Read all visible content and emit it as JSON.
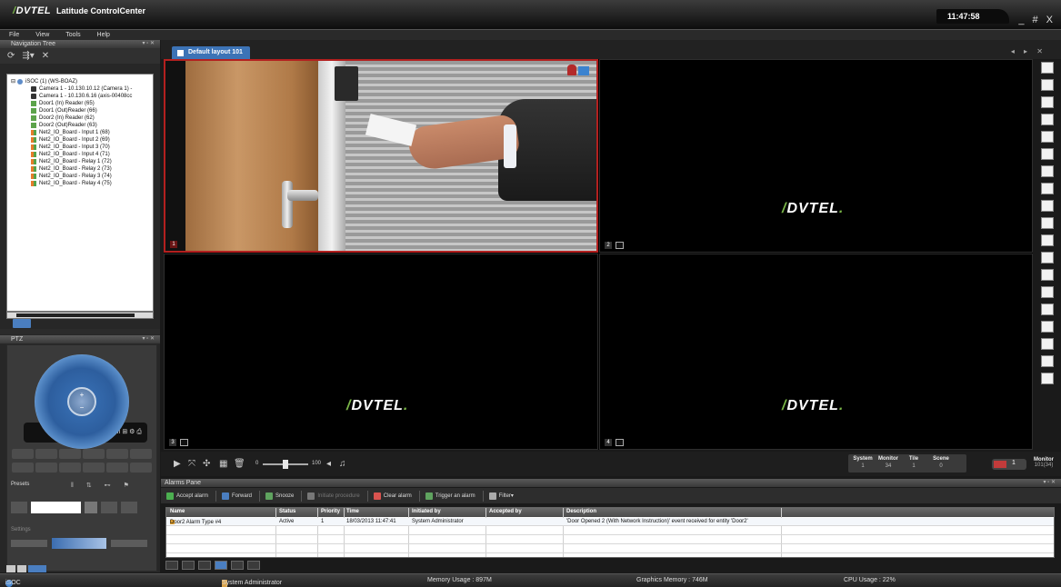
{
  "app": {
    "logo": "DVTEL",
    "title": "Latitude ControlCenter",
    "clock": "11:47:58",
    "window_controls": "_ # X"
  },
  "menu": [
    "File",
    "View",
    "Tools",
    "Help"
  ],
  "navigation_tree": {
    "title": "Navigation Tree",
    "items": [
      {
        "label": "iSOC (1) (WS-BOAZ)",
        "icon": "server-icon",
        "level": 0
      },
      {
        "label": "Camera 1 - 10.130.10.12 (Camera 1) -",
        "icon": "camera-icon",
        "level": 1
      },
      {
        "label": "Camera 1 - 10.130.6.16 (axis-00408cc",
        "icon": "camera-icon",
        "level": 1
      },
      {
        "label": "Door1 (In) Reader (65)",
        "icon": "door-reader-icon",
        "level": 1
      },
      {
        "label": "Door1 (Out)Reader (66)",
        "icon": "door-reader-icon",
        "level": 1
      },
      {
        "label": "Door2 (In) Reader (62)",
        "icon": "door-reader-icon",
        "level": 1
      },
      {
        "label": "Door2 (Out)Reader (63)",
        "icon": "door-reader-icon",
        "level": 1
      },
      {
        "label": "Net2_IO_Board - Input 1 (68)",
        "icon": "io-board-icon",
        "level": 1
      },
      {
        "label": "Net2_IO_Board - Input 2 (69)",
        "icon": "io-board-icon",
        "level": 1
      },
      {
        "label": "Net2_IO_Board - Input 3 (70)",
        "icon": "io-board-icon",
        "level": 1
      },
      {
        "label": "Net2_IO_Board - Input 4 (71)",
        "icon": "io-board-icon",
        "level": 1
      },
      {
        "label": "Net2_IO_Board - Relay 1 (72)",
        "icon": "io-board-icon",
        "level": 1
      },
      {
        "label": "Net2_IO_Board - Relay 2 (73)",
        "icon": "io-board-icon",
        "level": 1
      },
      {
        "label": "Net2_IO_Board - Relay 3 (74)",
        "icon": "io-board-icon",
        "level": 1
      },
      {
        "label": "Net2_IO_Board - Relay 4 (75)",
        "icon": "io-board-icon",
        "level": 1
      }
    ]
  },
  "ptz": {
    "title": "PTZ",
    "presets_label": "Presets",
    "settings_label": "Settings"
  },
  "layout": {
    "tab_label": "Default layout 101",
    "tiles": [
      {
        "number": "1",
        "content": "camera-feed",
        "selected": true
      },
      {
        "number": "2",
        "content": "DVTEL"
      },
      {
        "number": "3",
        "content": "DVTEL"
      },
      {
        "number": "4",
        "content": "DVTEL"
      }
    ]
  },
  "view_toolbar": {
    "zoom_min": "0",
    "zoom_max": "100",
    "status": [
      {
        "label": "System",
        "value": "1"
      },
      {
        "label": "Monitor",
        "value": "34"
      },
      {
        "label": "Tile",
        "value": "1"
      },
      {
        "label": "Scene",
        "value": "0"
      }
    ],
    "monitor_number": "1",
    "monitor_label": "Monitor",
    "monitor_id": "101(34)"
  },
  "alarms": {
    "title": "Alarms Pane",
    "actions": [
      {
        "label": "Accept alarm",
        "color": "#4caf50",
        "enabled": true
      },
      {
        "label": "Forward",
        "color": "#4a7ec0",
        "enabled": true
      },
      {
        "label": "Snooze",
        "color": "#5fa35f",
        "enabled": true
      },
      {
        "label": "Initiate procedure",
        "color": "#777777",
        "enabled": false
      },
      {
        "label": "Clear alarm",
        "color": "#d9534f",
        "enabled": true
      },
      {
        "label": "Trigger an alarm",
        "color": "#5fa35f",
        "enabled": true
      },
      {
        "label": "Filter",
        "color": "#aaaaaa",
        "enabled": true
      }
    ],
    "columns": [
      "Name",
      "Status",
      "Priority",
      "Time",
      "Initiated by",
      "Accepted by",
      "Description"
    ],
    "rows": [
      {
        "name": "Door2 Alarm Type #4",
        "status": "Active",
        "priority": "1",
        "time": "18/03/2013 11:47:41",
        "initiated_by": "System Administrator",
        "accepted_by": "",
        "description": "'Door Opened 2 (With Network Instruction)' event received for entity 'Door2'"
      }
    ]
  },
  "status_bar": {
    "server": "iSOC",
    "user": "System Administrator",
    "memory": "Memory Usage : 897M",
    "graphics_memory": "Graphics Memory : 746M",
    "cpu": "CPU Usage : 22%"
  },
  "colors": {
    "accent": "#3c73b6",
    "selected_tile_border": "#b3201f",
    "brand_green": "#7ab648"
  }
}
